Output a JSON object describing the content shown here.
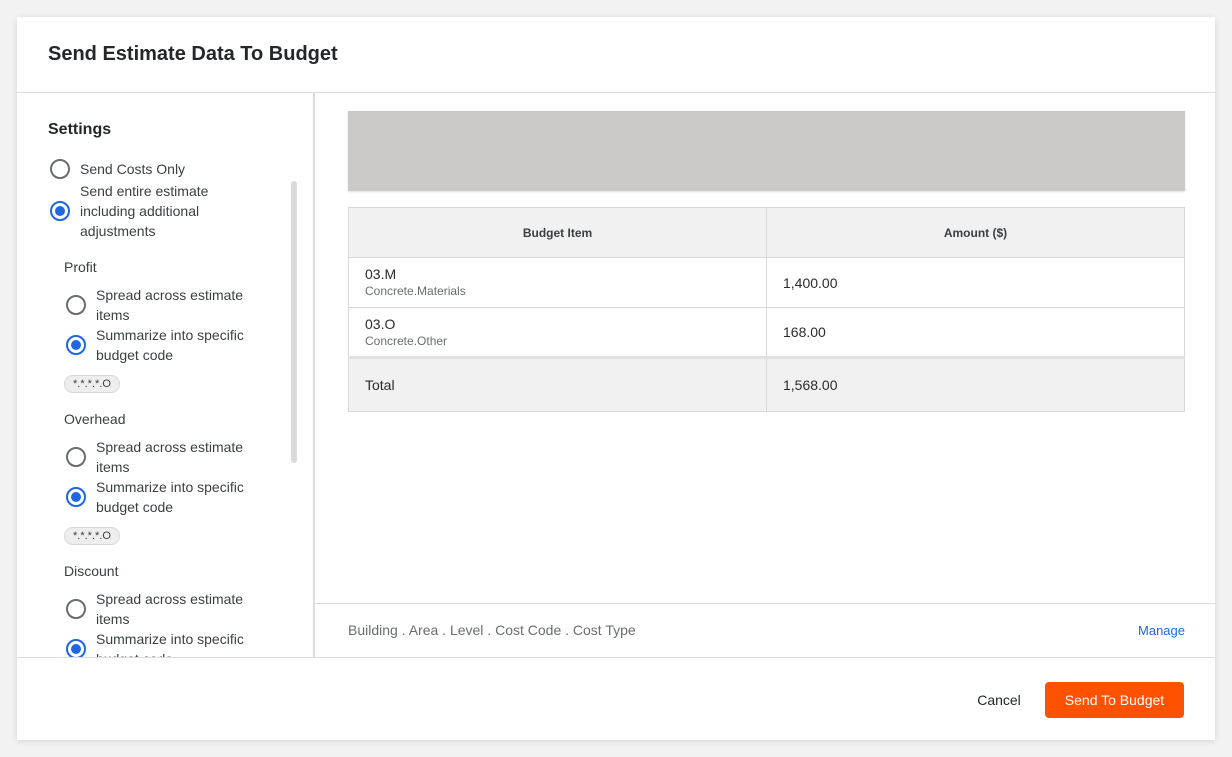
{
  "modal": {
    "title": "Send Estimate Data To Budget"
  },
  "settings": {
    "title": "Settings",
    "send_option_costs_only": "Send Costs Only",
    "send_option_entire_estimate": "Send entire estimate including additional adjustments",
    "selected_send_option": "entire_estimate",
    "groups": [
      {
        "title": "Profit",
        "spread_label": "Spread across estimate items",
        "summarize_label": "Summarize into specific budget code",
        "selected": "summarize",
        "code": "*.*.*.*.O"
      },
      {
        "title": "Overhead",
        "spread_label": "Spread across estimate items",
        "summarize_label": "Summarize into specific budget code",
        "selected": "summarize",
        "code": "*.*.*.*.O"
      },
      {
        "title": "Discount",
        "spread_label": "Spread across estimate items",
        "summarize_label": "Summarize into specific budget code",
        "selected": "summarize"
      }
    ]
  },
  "table": {
    "headers": {
      "budget_item": "Budget Item",
      "amount": "Amount ($)"
    },
    "rows": [
      {
        "code": "03.M",
        "description": "Concrete.Materials",
        "amount": "1,400.00"
      },
      {
        "code": "03.O",
        "description": "Concrete.Other",
        "amount": "168.00"
      }
    ],
    "total": {
      "label": "Total",
      "amount": "1,568.00"
    }
  },
  "footer": {
    "breakdown": "Building . Area . Level . Cost Code . Cost Type",
    "manage_label": "Manage",
    "cancel_label": "Cancel",
    "send_label": "Send To Budget"
  },
  "colors": {
    "accent_blue": "#2066df",
    "primary_orange": "#ff5200",
    "banner_gray": "#cbcac8"
  }
}
